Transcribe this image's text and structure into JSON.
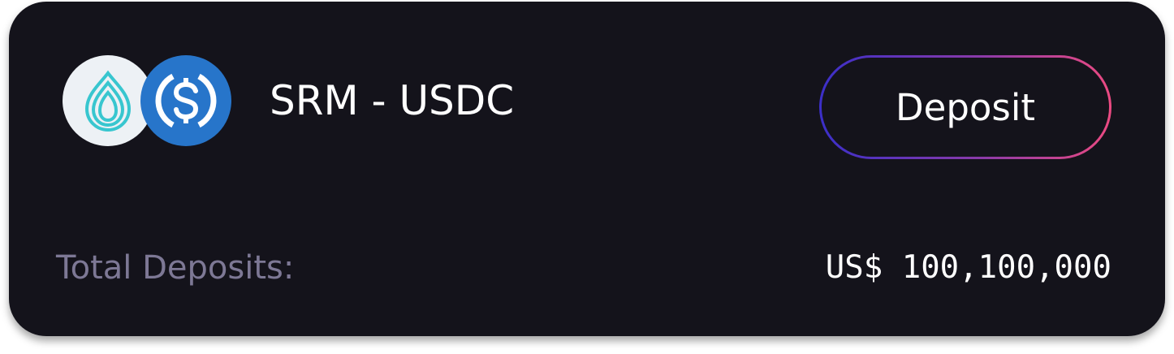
{
  "pool": {
    "pair_name": "SRM - USDC",
    "tokens": [
      {
        "symbol": "SRM",
        "icon": "serum-drop-icon",
        "color": "#38c6cf"
      },
      {
        "symbol": "USDC",
        "icon": "usdc-dollar-icon",
        "color": "#2775ca"
      }
    ]
  },
  "actions": {
    "deposit_label": "Deposit"
  },
  "stats": {
    "total_deposits_label": "Total Deposits:",
    "total_deposits_value": "US$ 100,100,000"
  },
  "colors": {
    "card_background": "#14131b",
    "button_gradient_start": "#3b2fc9",
    "button_gradient_end": "#ec4a82",
    "muted_text": "#7d7895"
  }
}
